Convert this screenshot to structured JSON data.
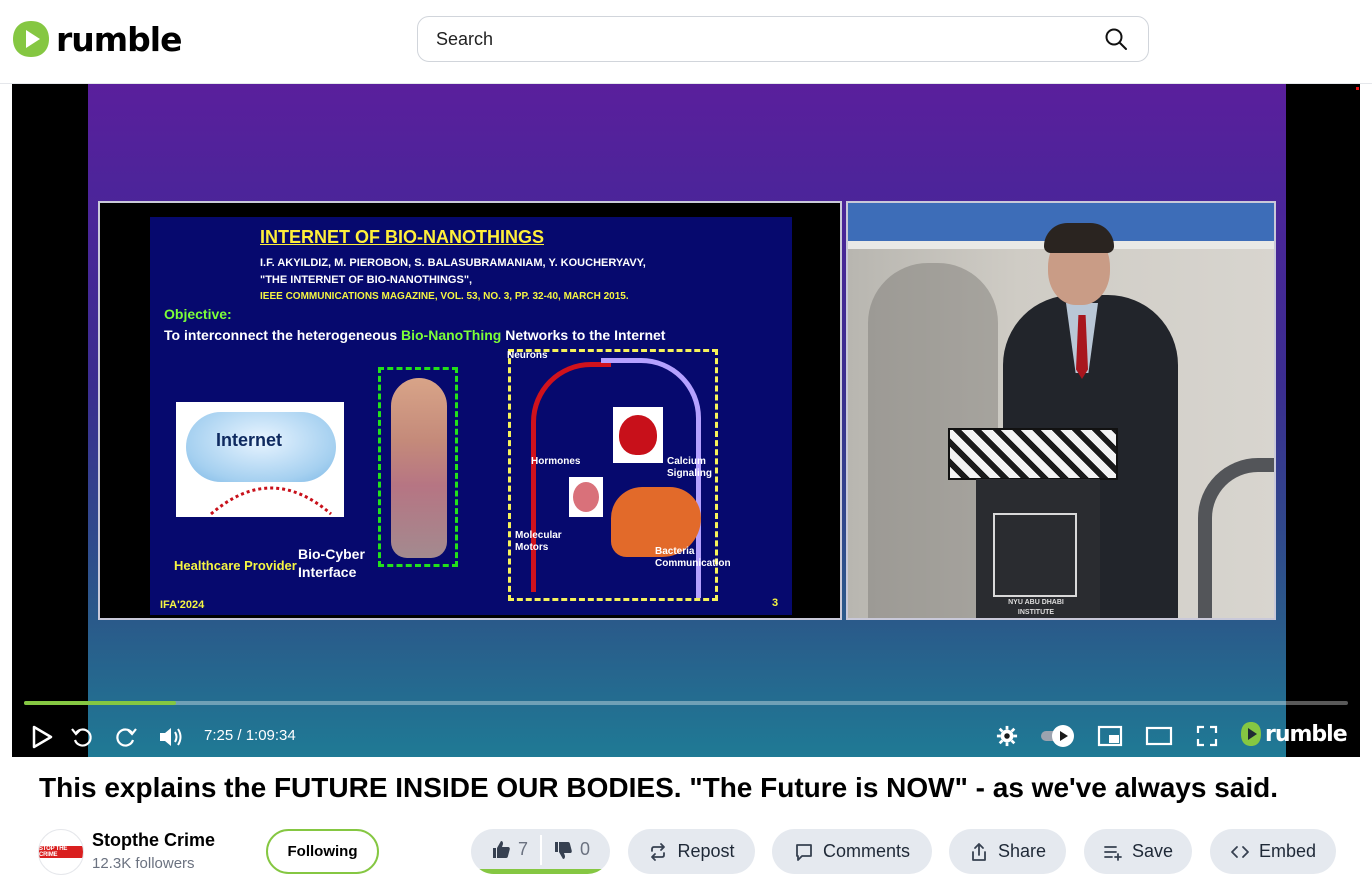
{
  "header": {
    "logo_text": "rumble",
    "search_placeholder": "Search"
  },
  "slide": {
    "title": "INTERNET OF BIO-NANOTHINGS",
    "authors": "I.F. AKYILDIZ, M. PIEROBON, S. BALASUBRAMANIAM, Y. KOUCHERYAVY,",
    "paper": "\"THE INTERNET OF BIO-NANOTHINGS\",",
    "journal": "IEEE COMMUNICATIONS MAGAZINE, VOL. 53, NO. 3, PP. 32-40, MARCH 2015.",
    "objective_label": "Objective:",
    "objective_text_1": "To interconnect the heterogeneous ",
    "objective_text_hl": "Bio-NanoThing",
    "objective_text_2": " Networks to the Internet",
    "internet_label": "Internet",
    "healthcare_label": "Healthcare Provider",
    "biocyber_label": "Bio-Cyber Interface",
    "neurons_label": "Neurons",
    "hormones_label": "Hormones",
    "calcium_label": "Calcium Signaling",
    "motors_label": "Molecular Motors",
    "bacteria_label": "Bacteria Communication",
    "footer": "IFA'2024",
    "page_num": "3",
    "podium_text_1": "NYU ABU DHABI",
    "podium_text_2": "INSTITUTE"
  },
  "player": {
    "time_display": "7:25 / 1:09:34",
    "progress_fraction": 0.1146,
    "watermark": "rumble",
    "accent": "#85c742"
  },
  "video": {
    "title": "This explains the FUTURE INSIDE OUR BODIES. \"The Future is NOW\" - as we've always said."
  },
  "channel": {
    "name": "Stopthe Crime",
    "followers": "12.3K followers",
    "avatar_text": "STOP THE CRIME",
    "follow_label": "Following"
  },
  "actions": {
    "likes": "7",
    "dislikes": "0",
    "like_fraction": 1.0,
    "repost": "Repost",
    "comments": "Comments",
    "share": "Share",
    "save": "Save",
    "embed": "Embed"
  }
}
